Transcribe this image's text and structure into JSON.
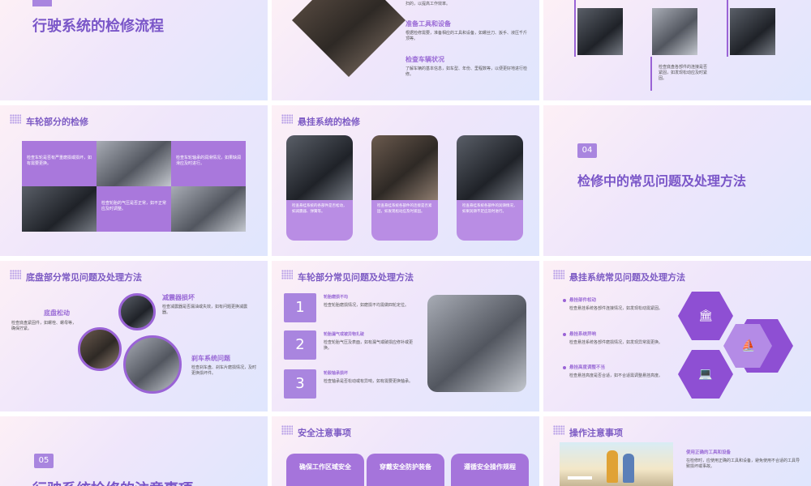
{
  "s1": {
    "title": "行驶系统的检修流程"
  },
  "s2": {
    "top_text": "扫的，以提高工作效率。",
    "h1": "准备工具和设备",
    "t1": "根据检修需要，准备相应的工具和设备，如螺丝刀、扳手、液压千斤顶等。",
    "h2": "检查车辆状况",
    "t2": "了解车辆的基本信息，如车型、年份、里程数等，以便更好地进行检修。"
  },
  "s3": {
    "caption": "检查底盘各部件的连接是否紧固，如发现松动应及时紧固。"
  },
  "s4": {
    "title": "车轮部分的检修",
    "t1": "检查车轮是否有严重磨损或损坏，如有需要更换。",
    "t2": "检查车轮轴承的润滑情况，如果缺润滑应及时进行。",
    "t3": "检查轮胎的气压是否正常，如不正常应及时调整。"
  },
  "s5": {
    "title": "悬挂系统的检修",
    "c1": "检查悬挂系统的各部件是否松动，如减震器、弹簧等。",
    "c2": "检查悬挂系统各部件的连接是否紧固，如发现松动应及时紧固。",
    "c3": "检查悬挂系统各部件的润滑情况，如果润滑不足应及时进行。"
  },
  "s6": {
    "num": "04",
    "title": "检修中的常见问题及处理方法"
  },
  "s7": {
    "title": "底盘部分常见问题及处理方法",
    "h1": "减震器损坏",
    "t1": "检查减震器是否漏油或失效，如有问题更换减震器。",
    "h2": "底盘松动",
    "t2": "检查底盘紧固件，如螺栓、螺母等，确保拧紧。",
    "h3": "刹车系统问题",
    "t3": "检查刹车盘、刹车片磨损情况，及时更换损坏件。"
  },
  "s8": {
    "title": "车轮部分常见问题及处理方法",
    "items": [
      {
        "n": "1",
        "h": "轮胎磨损不均",
        "t": "检查轮胎磨损情况，如磨损不均需做四轮定位。"
      },
      {
        "n": "2",
        "h": "轮胎漏气或被异物扎破",
        "t": "检查轮胎气压及表面，如有漏气或破损应修补或更换。"
      },
      {
        "n": "3",
        "h": "轮毂轴承损坏",
        "t": "检查轴承是否松动或有异响，如有需要更换轴承。"
      }
    ]
  },
  "s9": {
    "title": "悬挂系统常见问题及处理方法",
    "items": [
      {
        "h": "悬挂部件松动",
        "t": "检查悬挂系统各部件连接情况，如发现松动需紧固。"
      },
      {
        "h": "悬挂系统异响",
        "t": "检查悬挂系统各部件磨损情况，如发现异常需更换。"
      },
      {
        "h": "悬挂高度调整不当",
        "t": "检查悬挂高度是否合适，如不合适需调整悬挂高度。"
      }
    ],
    "icons": [
      "bank-icon",
      "sailboat-icon",
      "laptop-icon"
    ]
  },
  "s10": {
    "num": "05",
    "title": "行驶系统检修的注意事项"
  },
  "s11": {
    "title": "安全注意事项",
    "p1": "确保工作区域安全",
    "p2": "穿戴安全防护装备",
    "p3": "遵循安全操作规程"
  },
  "s12": {
    "title": "操作注意事项",
    "h": "使用正确的工具和设备",
    "t": "在检修时，应使用正确的工具和设备，避免使用不合适的工具导致损坏或事故。"
  },
  "colors": {
    "accent": "#a978dc",
    "title": "#7a56c8"
  }
}
